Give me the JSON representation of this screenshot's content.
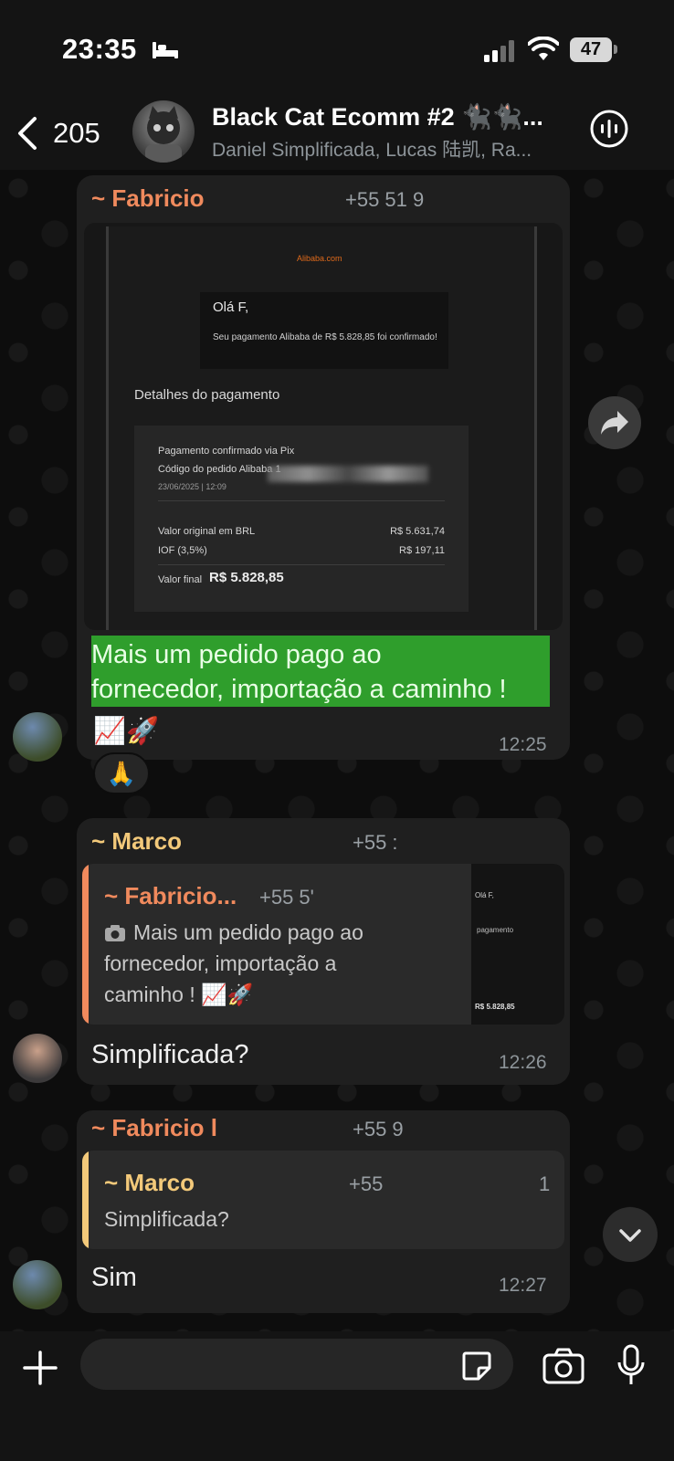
{
  "status_bar": {
    "time": "23:35",
    "battery": "47"
  },
  "header": {
    "back_count": "205",
    "title": "Black Cat Ecomm #2 🐈‍⬛🐈‍⬛...",
    "subtitle": "Daniel Simplificada, Lucas 陆凯, Ra..."
  },
  "messages": [
    {
      "sender": "~ Fabricio",
      "phone": "+55 51 9",
      "screenshot": {
        "logo": "Alibaba.com",
        "greeting": "Olá F,",
        "confirmation": "Seu pagamento Alibaba de R$ 5.828,85 foi confirmado!",
        "details_title": "Detalhes do pagamento",
        "pix_line": "Pagamento confirmado via Pix",
        "order_code_label": "Código do pedido Alibaba 1",
        "date": "23/06/2025 | 12:09",
        "original_label": "Valor original em BRL",
        "original_value": "R$ 5.631,74",
        "iof_label": "IOF (3,5%)",
        "iof_value": "R$ 197,11",
        "final_label": "Valor final",
        "final_value": "R$ 5.828,85"
      },
      "text_line1": "Mais um pedido pago ao",
      "text_line2": "fornecedor, importação a caminho !",
      "emojis": "📈🚀",
      "time": "12:25",
      "reaction": "🙏"
    },
    {
      "sender": "~ Marco",
      "phone": "+55 :",
      "quote": {
        "sender": "~ Fabricio...",
        "phone": "+55 5'",
        "line1": "Mais um pedido pago ao",
        "line2": "fornecedor, importação a",
        "line3": "caminho ! 📈🚀",
        "thumb_greeting": "Olá F,",
        "thumb_section": "pagamento",
        "thumb_total": "R$ 5.828,85"
      },
      "text": "Simplificada?",
      "time": "12:26"
    },
    {
      "sender": "~ Fabricio l",
      "phone": "+55 9",
      "quote": {
        "sender": "~ Marco",
        "phone": "+55",
        "phone_tail": "1",
        "text": "Simplificada?"
      },
      "text": "Sim",
      "time": "12:27"
    }
  ],
  "colors": {
    "fabricio": "#f08a5d",
    "marco": "#f3c97a",
    "highlight": "#2f9e2c"
  }
}
